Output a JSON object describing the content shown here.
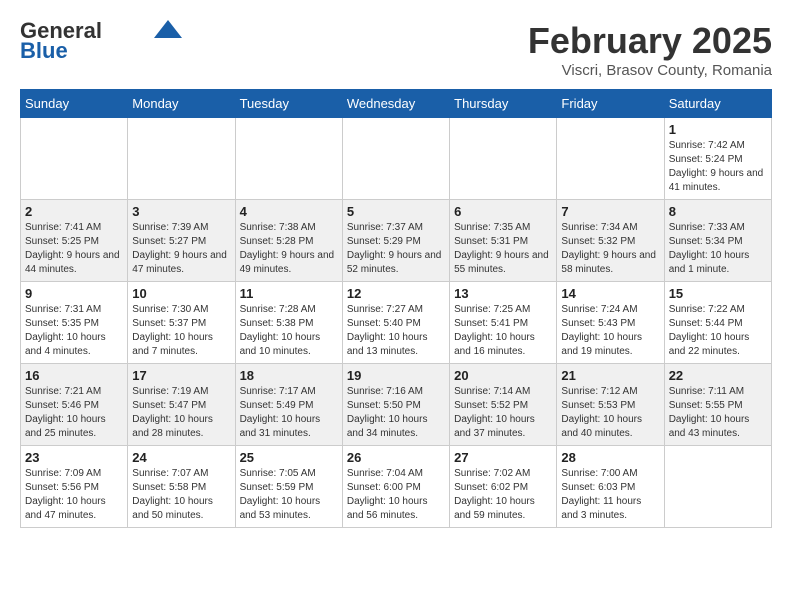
{
  "header": {
    "logo_general": "General",
    "logo_blue": "Blue",
    "title": "February 2025",
    "subtitle": "Viscri, Brasov County, Romania"
  },
  "calendar": {
    "days_of_week": [
      "Sunday",
      "Monday",
      "Tuesday",
      "Wednesday",
      "Thursday",
      "Friday",
      "Saturday"
    ],
    "weeks": [
      {
        "shaded": false,
        "days": [
          {
            "num": "",
            "info": ""
          },
          {
            "num": "",
            "info": ""
          },
          {
            "num": "",
            "info": ""
          },
          {
            "num": "",
            "info": ""
          },
          {
            "num": "",
            "info": ""
          },
          {
            "num": "",
            "info": ""
          },
          {
            "num": "1",
            "info": "Sunrise: 7:42 AM\nSunset: 5:24 PM\nDaylight: 9 hours and 41 minutes."
          }
        ]
      },
      {
        "shaded": true,
        "days": [
          {
            "num": "2",
            "info": "Sunrise: 7:41 AM\nSunset: 5:25 PM\nDaylight: 9 hours and 44 minutes."
          },
          {
            "num": "3",
            "info": "Sunrise: 7:39 AM\nSunset: 5:27 PM\nDaylight: 9 hours and 47 minutes."
          },
          {
            "num": "4",
            "info": "Sunrise: 7:38 AM\nSunset: 5:28 PM\nDaylight: 9 hours and 49 minutes."
          },
          {
            "num": "5",
            "info": "Sunrise: 7:37 AM\nSunset: 5:29 PM\nDaylight: 9 hours and 52 minutes."
          },
          {
            "num": "6",
            "info": "Sunrise: 7:35 AM\nSunset: 5:31 PM\nDaylight: 9 hours and 55 minutes."
          },
          {
            "num": "7",
            "info": "Sunrise: 7:34 AM\nSunset: 5:32 PM\nDaylight: 9 hours and 58 minutes."
          },
          {
            "num": "8",
            "info": "Sunrise: 7:33 AM\nSunset: 5:34 PM\nDaylight: 10 hours and 1 minute."
          }
        ]
      },
      {
        "shaded": false,
        "days": [
          {
            "num": "9",
            "info": "Sunrise: 7:31 AM\nSunset: 5:35 PM\nDaylight: 10 hours and 4 minutes."
          },
          {
            "num": "10",
            "info": "Sunrise: 7:30 AM\nSunset: 5:37 PM\nDaylight: 10 hours and 7 minutes."
          },
          {
            "num": "11",
            "info": "Sunrise: 7:28 AM\nSunset: 5:38 PM\nDaylight: 10 hours and 10 minutes."
          },
          {
            "num": "12",
            "info": "Sunrise: 7:27 AM\nSunset: 5:40 PM\nDaylight: 10 hours and 13 minutes."
          },
          {
            "num": "13",
            "info": "Sunrise: 7:25 AM\nSunset: 5:41 PM\nDaylight: 10 hours and 16 minutes."
          },
          {
            "num": "14",
            "info": "Sunrise: 7:24 AM\nSunset: 5:43 PM\nDaylight: 10 hours and 19 minutes."
          },
          {
            "num": "15",
            "info": "Sunrise: 7:22 AM\nSunset: 5:44 PM\nDaylight: 10 hours and 22 minutes."
          }
        ]
      },
      {
        "shaded": true,
        "days": [
          {
            "num": "16",
            "info": "Sunrise: 7:21 AM\nSunset: 5:46 PM\nDaylight: 10 hours and 25 minutes."
          },
          {
            "num": "17",
            "info": "Sunrise: 7:19 AM\nSunset: 5:47 PM\nDaylight: 10 hours and 28 minutes."
          },
          {
            "num": "18",
            "info": "Sunrise: 7:17 AM\nSunset: 5:49 PM\nDaylight: 10 hours and 31 minutes."
          },
          {
            "num": "19",
            "info": "Sunrise: 7:16 AM\nSunset: 5:50 PM\nDaylight: 10 hours and 34 minutes."
          },
          {
            "num": "20",
            "info": "Sunrise: 7:14 AM\nSunset: 5:52 PM\nDaylight: 10 hours and 37 minutes."
          },
          {
            "num": "21",
            "info": "Sunrise: 7:12 AM\nSunset: 5:53 PM\nDaylight: 10 hours and 40 minutes."
          },
          {
            "num": "22",
            "info": "Sunrise: 7:11 AM\nSunset: 5:55 PM\nDaylight: 10 hours and 43 minutes."
          }
        ]
      },
      {
        "shaded": false,
        "days": [
          {
            "num": "23",
            "info": "Sunrise: 7:09 AM\nSunset: 5:56 PM\nDaylight: 10 hours and 47 minutes."
          },
          {
            "num": "24",
            "info": "Sunrise: 7:07 AM\nSunset: 5:58 PM\nDaylight: 10 hours and 50 minutes."
          },
          {
            "num": "25",
            "info": "Sunrise: 7:05 AM\nSunset: 5:59 PM\nDaylight: 10 hours and 53 minutes."
          },
          {
            "num": "26",
            "info": "Sunrise: 7:04 AM\nSunset: 6:00 PM\nDaylight: 10 hours and 56 minutes."
          },
          {
            "num": "27",
            "info": "Sunrise: 7:02 AM\nSunset: 6:02 PM\nDaylight: 10 hours and 59 minutes."
          },
          {
            "num": "28",
            "info": "Sunrise: 7:00 AM\nSunset: 6:03 PM\nDaylight: 11 hours and 3 minutes."
          },
          {
            "num": "",
            "info": ""
          }
        ]
      }
    ]
  }
}
